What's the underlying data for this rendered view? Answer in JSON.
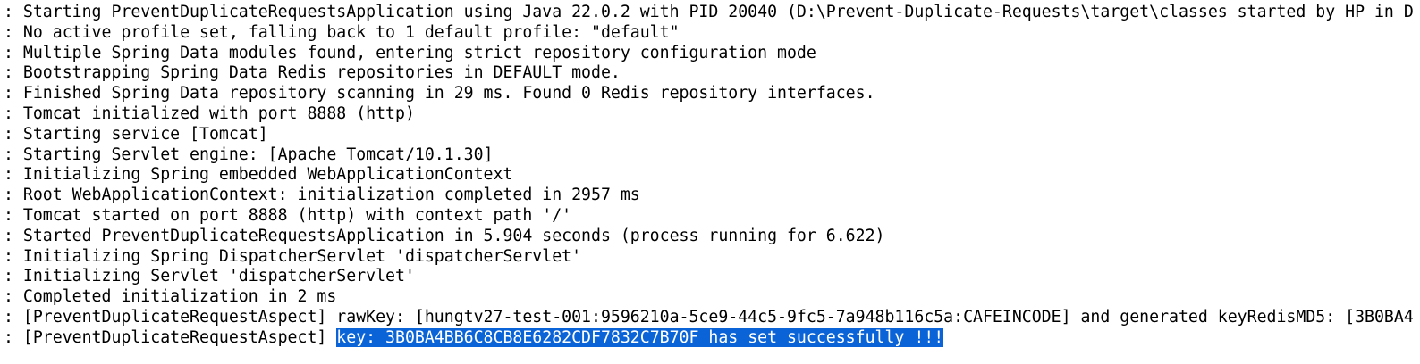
{
  "console": {
    "lines": [
      {
        "text": ": Starting PreventDuplicateRequestsApplication using Java 22.0.2 with PID 20040 (D:\\Prevent-Duplicate-Requests\\target\\classes started by HP in D"
      },
      {
        "text": ": No active profile set, falling back to 1 default profile: \"default\""
      },
      {
        "text": ": Multiple Spring Data modules found, entering strict repository configuration mode"
      },
      {
        "text": ": Bootstrapping Spring Data Redis repositories in DEFAULT mode."
      },
      {
        "text": ": Finished Spring Data repository scanning in 29 ms. Found 0 Redis repository interfaces."
      },
      {
        "text": ": Tomcat initialized with port 8888 (http)"
      },
      {
        "text": ": Starting service [Tomcat]"
      },
      {
        "text": ": Starting Servlet engine: [Apache Tomcat/10.1.30]"
      },
      {
        "text": ": Initializing Spring embedded WebApplicationContext"
      },
      {
        "text": ": Root WebApplicationContext: initialization completed in 2957 ms"
      },
      {
        "text": ": Tomcat started on port 8888 (http) with context path '/'"
      },
      {
        "text": ": Started PreventDuplicateRequestsApplication in 5.904 seconds (process running for 6.622)"
      },
      {
        "text": ": Initializing Spring DispatcherServlet 'dispatcherServlet'"
      },
      {
        "text": ": Initializing Servlet 'dispatcherServlet'"
      },
      {
        "text": ": Completed initialization in 2 ms"
      },
      {
        "text": ": [PreventDuplicateRequestAspect] rawKey: [hungtv27-test-001:9596210a-5ce9-44c5-9fc5-7a948b116c5a:CAFEINCODE] and generated keyRedisMD5: [3B0BA4"
      }
    ],
    "last_line": {
      "prefix": ": [PreventDuplicateRequestAspect] ",
      "selected": "key: 3B0BA4BB6C8CB8E6282CDF7832C7B70F has set successfully !!!"
    },
    "colors": {
      "selection": "#0a64d8",
      "text": "#000000",
      "background": "#ffffff"
    }
  }
}
